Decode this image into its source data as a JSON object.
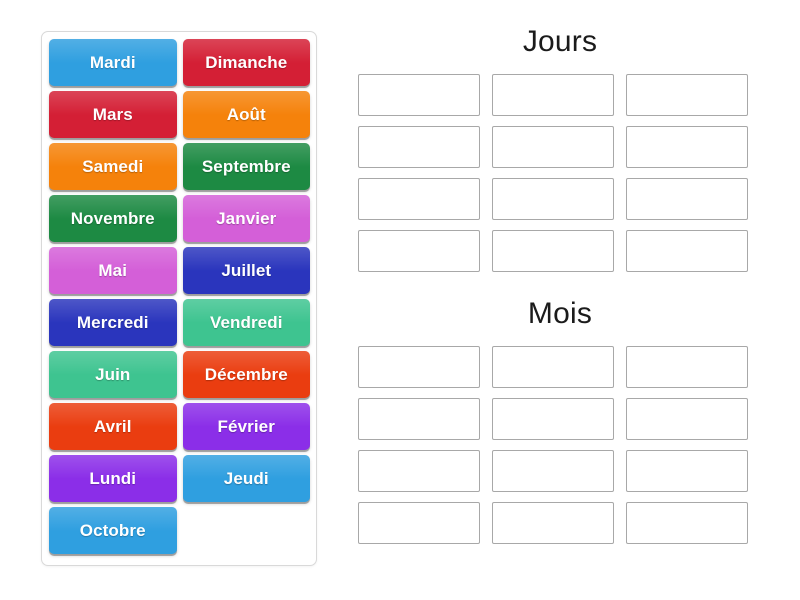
{
  "word_bank": {
    "name": "word-bank",
    "tiles": [
      {
        "label": "Mardi",
        "color": "#2f9fe0"
      },
      {
        "label": "Dimanche",
        "color": "#d41f35"
      },
      {
        "label": "Mars",
        "color": "#d41f35"
      },
      {
        "label": "Août",
        "color": "#f5820b"
      },
      {
        "label": "Samedi",
        "color": "#f5820b"
      },
      {
        "label": "Septembre",
        "color": "#1d8a43"
      },
      {
        "label": "Novembre",
        "color": "#1d8a43"
      },
      {
        "label": "Janvier",
        "color": "#d45fd8"
      },
      {
        "label": "Mai",
        "color": "#d45fd8"
      },
      {
        "label": "Juillet",
        "color": "#2a35bd"
      },
      {
        "label": "Mercredi",
        "color": "#2a35bd"
      },
      {
        "label": "Vendredi",
        "color": "#3ec490"
      },
      {
        "label": "Juin",
        "color": "#3ec490"
      },
      {
        "label": "Décembre",
        "color": "#ea3d10"
      },
      {
        "label": "Avril",
        "color": "#ea3d10"
      },
      {
        "label": "Février",
        "color": "#8b2ee8"
      },
      {
        "label": "Lundi",
        "color": "#8b2ee8"
      },
      {
        "label": "Jeudi",
        "color": "#2f9fe0"
      },
      {
        "label": "Octobre",
        "color": "#2f9fe0"
      }
    ]
  },
  "groups": [
    {
      "title": "Jours",
      "slot_count": 12,
      "slots": [
        "",
        "",
        "",
        "",
        "",
        "",
        "",
        "",
        "",
        "",
        "",
        ""
      ]
    },
    {
      "title": "Mois",
      "slot_count": 12,
      "slots": [
        "",
        "",
        "",
        "",
        "",
        "",
        "",
        "",
        "",
        "",
        "",
        ""
      ]
    }
  ],
  "colors": {
    "blue": "#2f9fe0",
    "crimson": "#d41f35",
    "orange": "#f5820b",
    "green": "#1d8a43",
    "orchid": "#d45fd8",
    "royal_blue": "#2a35bd",
    "sea_green": "#3ec490",
    "red_orange": "#ea3d10",
    "purple": "#8b2ee8",
    "slot_border": "#a8a8a8",
    "panel_border": "#d9d9d9",
    "title_text": "#1b1b1b"
  }
}
